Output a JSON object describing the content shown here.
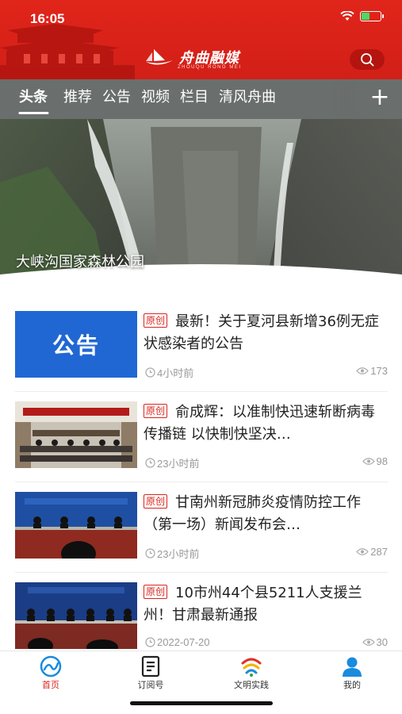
{
  "status_bar": {
    "time": "16:05"
  },
  "header": {
    "brand_name": "舟曲融媒",
    "brand_sub": "ZHOUQU RONG MEI"
  },
  "tabs": [
    {
      "label": "头条",
      "active": true
    },
    {
      "label": "推荐"
    },
    {
      "label": "公告"
    },
    {
      "label": "视频"
    },
    {
      "label": "栏目"
    },
    {
      "label": "清风舟曲"
    }
  ],
  "tab_add_label": "+",
  "banner": {
    "caption": "大峡沟国家森林公园",
    "slide_count": 4,
    "active_slide": 3
  },
  "news": [
    {
      "thumb_text": "公告",
      "tag": "原创",
      "title": "最新！关于夏河县新增36例无症状感染者的公告",
      "time": "4小时前",
      "views": "173"
    },
    {
      "tag": "原创",
      "title": "俞成辉：以准制快迅速斩断病毒传播链 以快制快坚决…",
      "time": "23小时前",
      "views": "98"
    },
    {
      "tag": "原创",
      "title": "甘南州新冠肺炎疫情防控工作（第一场）新闻发布会…",
      "time": "23小时前",
      "views": "287"
    },
    {
      "tag": "原创",
      "title": "10市州44个县5211人支援兰州！甘肃最新通报",
      "time": "2022-07-20",
      "views": "30"
    }
  ],
  "bottom_nav": [
    {
      "label": "首页",
      "icon": "home-swirl-icon",
      "active": true
    },
    {
      "label": "订阅号",
      "icon": "subscription-icon"
    },
    {
      "label": "文明实践",
      "icon": "civilization-practice-icon"
    },
    {
      "label": "我的",
      "icon": "user-profile-icon"
    }
  ],
  "colors": {
    "header_red": "#e1251b",
    "tag_red": "#d8261f",
    "tab_bar_gray": "#6a6e6d",
    "notice_blue": "#2067d3",
    "nav_blue": "#1a8bde"
  }
}
